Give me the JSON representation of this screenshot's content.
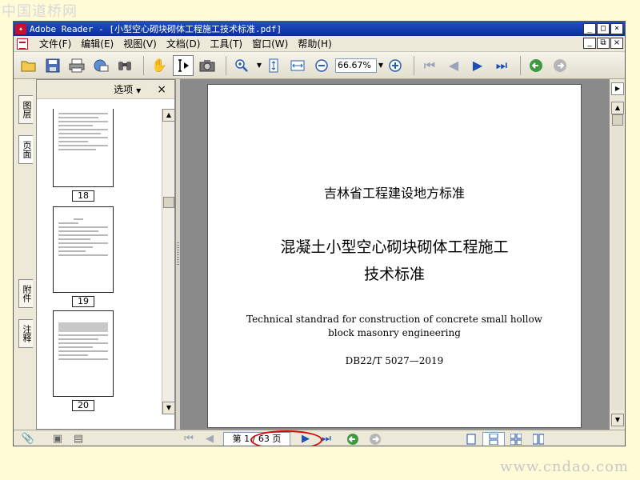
{
  "watermarks": {
    "top": "中国道桥网",
    "bottom": "www.cndao.com"
  },
  "window": {
    "title": "Adobe Reader - [小型空心砌块砌体工程施工技术标准.pdf]",
    "app_icon": "adobe-reader-icon",
    "controls": [
      "_",
      "□",
      "×"
    ]
  },
  "menu": {
    "items": [
      "文件(F)",
      "编辑(E)",
      "视图(V)",
      "文档(D)",
      "工具(T)",
      "窗口(W)",
      "帮助(H)"
    ],
    "doc_controls": [
      "_",
      "⧉",
      "×"
    ]
  },
  "toolbar": {
    "zoom_value": "66.67%",
    "buttons": [
      "open-folder-icon",
      "save-icon",
      "print-icon",
      "email-icon",
      "search-binoculars-icon",
      "hand-tool-icon",
      "select-text-icon",
      "snapshot-icon",
      "zoom-in-icon",
      "fit-page-icon",
      "fit-width-icon",
      "zoom-out-icon",
      "zoom-in-plus-icon",
      "first-page-icon",
      "previous-page-icon",
      "next-page-icon",
      "last-page-icon",
      "go-back-icon",
      "go-forward-icon"
    ]
  },
  "side_tabs": [
    "图层",
    "页面",
    "附件",
    "注释"
  ],
  "panel": {
    "options_label": "选项",
    "close": "×",
    "thumbnails": [
      {
        "label": "18"
      },
      {
        "label": "19"
      },
      {
        "label": "20"
      }
    ]
  },
  "document": {
    "province": "吉林省工程建设地方标准",
    "title_line1": "混凝土小型空心砌块砌体工程施工",
    "title_line2": "技术标准",
    "english_line1": "Technical standrad for construction of concrete small hollow",
    "english_line2": "block masonry engineering",
    "code": "DB22/T 5027—2019"
  },
  "statusbar": {
    "page_indicator": "第 1 / 63 页",
    "buttons": [
      "attachment-clip-icon",
      "monitor-icon",
      "page-icon",
      "first-page-icon",
      "previous-page-icon",
      "next-page-icon",
      "last-page-icon",
      "go-back-icon",
      "go-forward-icon",
      "single-page-icon",
      "continuous-icon",
      "facing-icon",
      "continuous-facing-icon"
    ]
  },
  "colors": {
    "titlebar": "#0a2e9c",
    "annotation_circle": "#dd0000",
    "background": "#fffbd6"
  }
}
